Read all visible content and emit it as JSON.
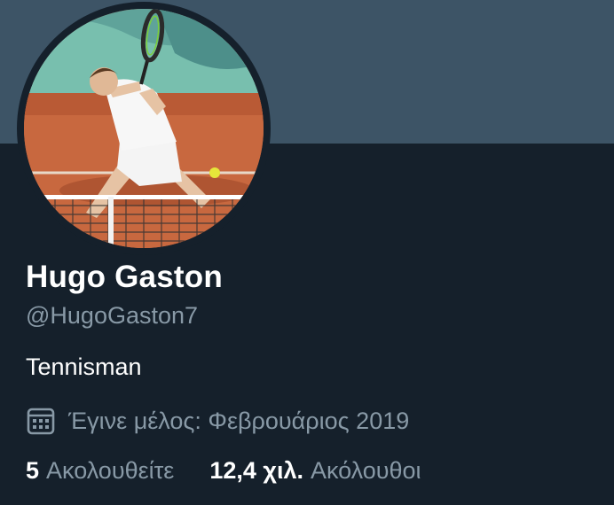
{
  "profile": {
    "name": "Hugo Gaston",
    "handle": "@HugoGaston7",
    "bio": "Tennisman",
    "joined": "Έγινε μέλος: Φεβρουάριος 2019"
  },
  "stats": {
    "following_count": "5",
    "following_label": "Ακολουθείτε",
    "followers_count": "12,4 χιλ.",
    "followers_label": "Ακόλουθοι"
  },
  "colors": {
    "background": "#15202b",
    "banner": "#3d5466",
    "primary_text": "#ffffff",
    "secondary_text": "#8899a6"
  },
  "icons": {
    "joined": "calendar-icon"
  }
}
